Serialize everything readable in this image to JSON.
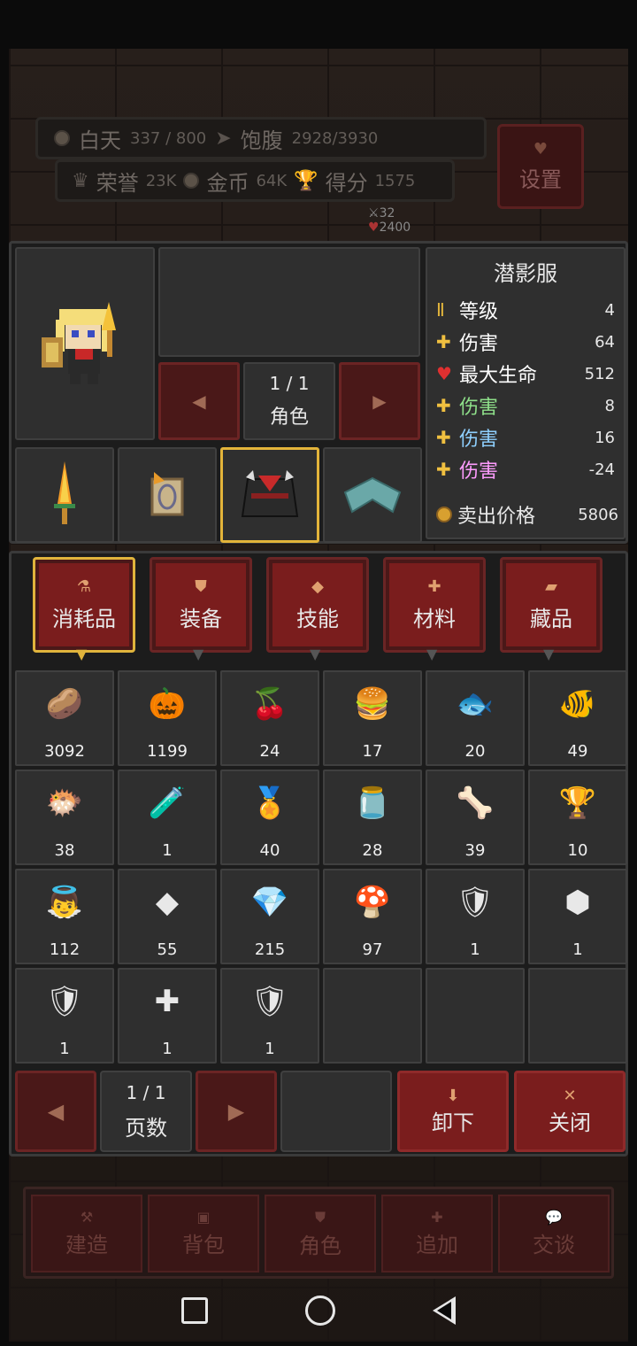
{
  "hud": {
    "day_label": "白天",
    "day_value": "337 / 800",
    "hunger_label": "饱腹",
    "hunger_value": "2928/3930",
    "honor_label": "荣誉",
    "honor_value": "23K",
    "gold_label": "金币",
    "gold_value": "64K",
    "score_label": "得分",
    "score_value": "1575",
    "settings_label": "设置",
    "mini_attack": "32",
    "mini_hp": "2400"
  },
  "equip": {
    "pager": "1 / 1",
    "pager_label": "角色",
    "item_name": "潜影服",
    "stats": [
      {
        "icon": "roman-two-icon",
        "name": "等级",
        "value": "4",
        "color": "#ffffff"
      },
      {
        "icon": "cross-icon",
        "name": "伤害",
        "value": "64",
        "color": "#ffffff"
      },
      {
        "icon": "heart-icon",
        "name": "最大生命",
        "value": "512",
        "color": "#ffffff"
      },
      {
        "icon": "cross-icon",
        "name": "伤害",
        "value": "8",
        "color": "#8fe08a"
      },
      {
        "icon": "cross-icon",
        "name": "伤害",
        "value": "16",
        "color": "#8fd0ff"
      },
      {
        "icon": "cross-icon",
        "name": "伤害",
        "value": "-24",
        "color": "#ff9cff"
      }
    ],
    "sell_label": "卖出价格",
    "sell_value": "5806"
  },
  "tabs": [
    {
      "label": "消耗品",
      "icon": "flask-icon"
    },
    {
      "label": "装备",
      "icon": "shield-icon"
    },
    {
      "label": "技能",
      "icon": "diamond-icon"
    },
    {
      "label": "材料",
      "icon": "cross-icon"
    },
    {
      "label": "藏品",
      "icon": "scroll-icon"
    }
  ],
  "items": [
    {
      "icon": "turnip-icon",
      "glyph": "🥔",
      "count": "3092"
    },
    {
      "icon": "pumpkin-icon",
      "glyph": "🎃",
      "count": "1199"
    },
    {
      "icon": "cherries-icon",
      "glyph": "🍒",
      "count": "24"
    },
    {
      "icon": "burger-icon",
      "glyph": "🍔",
      "count": "17"
    },
    {
      "icon": "fish-icon",
      "glyph": "🐟",
      "count": "20"
    },
    {
      "icon": "fish-bone-icon",
      "glyph": "🐠",
      "count": "49"
    },
    {
      "icon": "pufferfish-icon",
      "glyph": "🐡",
      "count": "38"
    },
    {
      "icon": "potion-icon",
      "glyph": "🧪",
      "count": "1"
    },
    {
      "icon": "medal-icon",
      "glyph": "🏅",
      "count": "40"
    },
    {
      "icon": "jar-icon",
      "glyph": "🫙",
      "count": "28"
    },
    {
      "icon": "bone-icon",
      "glyph": "🦴",
      "count": "39"
    },
    {
      "icon": "goblet-icon",
      "glyph": "🏆",
      "count": "10"
    },
    {
      "icon": "angel-statue-icon",
      "glyph": "👼",
      "count": "112"
    },
    {
      "icon": "gold-cube-statue-icon",
      "glyph": "◆",
      "count": "55"
    },
    {
      "icon": "crystal-statue-icon",
      "glyph": "💎",
      "count": "215"
    },
    {
      "icon": "rust-statue-icon",
      "glyph": "🍄",
      "count": "97"
    },
    {
      "icon": "iron-shield-icon",
      "glyph": "🛡",
      "count": "1"
    },
    {
      "icon": "cross-hex-icon",
      "glyph": "⬢",
      "count": "1"
    },
    {
      "icon": "gold-shield-icon",
      "glyph": "🛡",
      "count": "1"
    },
    {
      "icon": "pink-cross-icon",
      "glyph": "✚",
      "count": "1"
    },
    {
      "icon": "pink-shield-icon",
      "glyph": "🛡",
      "count": "1"
    },
    {
      "icon": "",
      "glyph": "",
      "count": ""
    },
    {
      "icon": "",
      "glyph": "",
      "count": ""
    },
    {
      "icon": "",
      "glyph": "",
      "count": ""
    }
  ],
  "bottom": {
    "pager": "1 / 1",
    "pager_label": "页数",
    "unequip_label": "卸下",
    "close_label": "关闭"
  },
  "menu": [
    {
      "label": "建造",
      "icon": "hammer-icon"
    },
    {
      "label": "背包",
      "icon": "bag-icon"
    },
    {
      "label": "角色",
      "icon": "shield-icon"
    },
    {
      "label": "追加",
      "icon": "plus-icon"
    },
    {
      "label": "交谈",
      "icon": "chat-icon"
    }
  ]
}
